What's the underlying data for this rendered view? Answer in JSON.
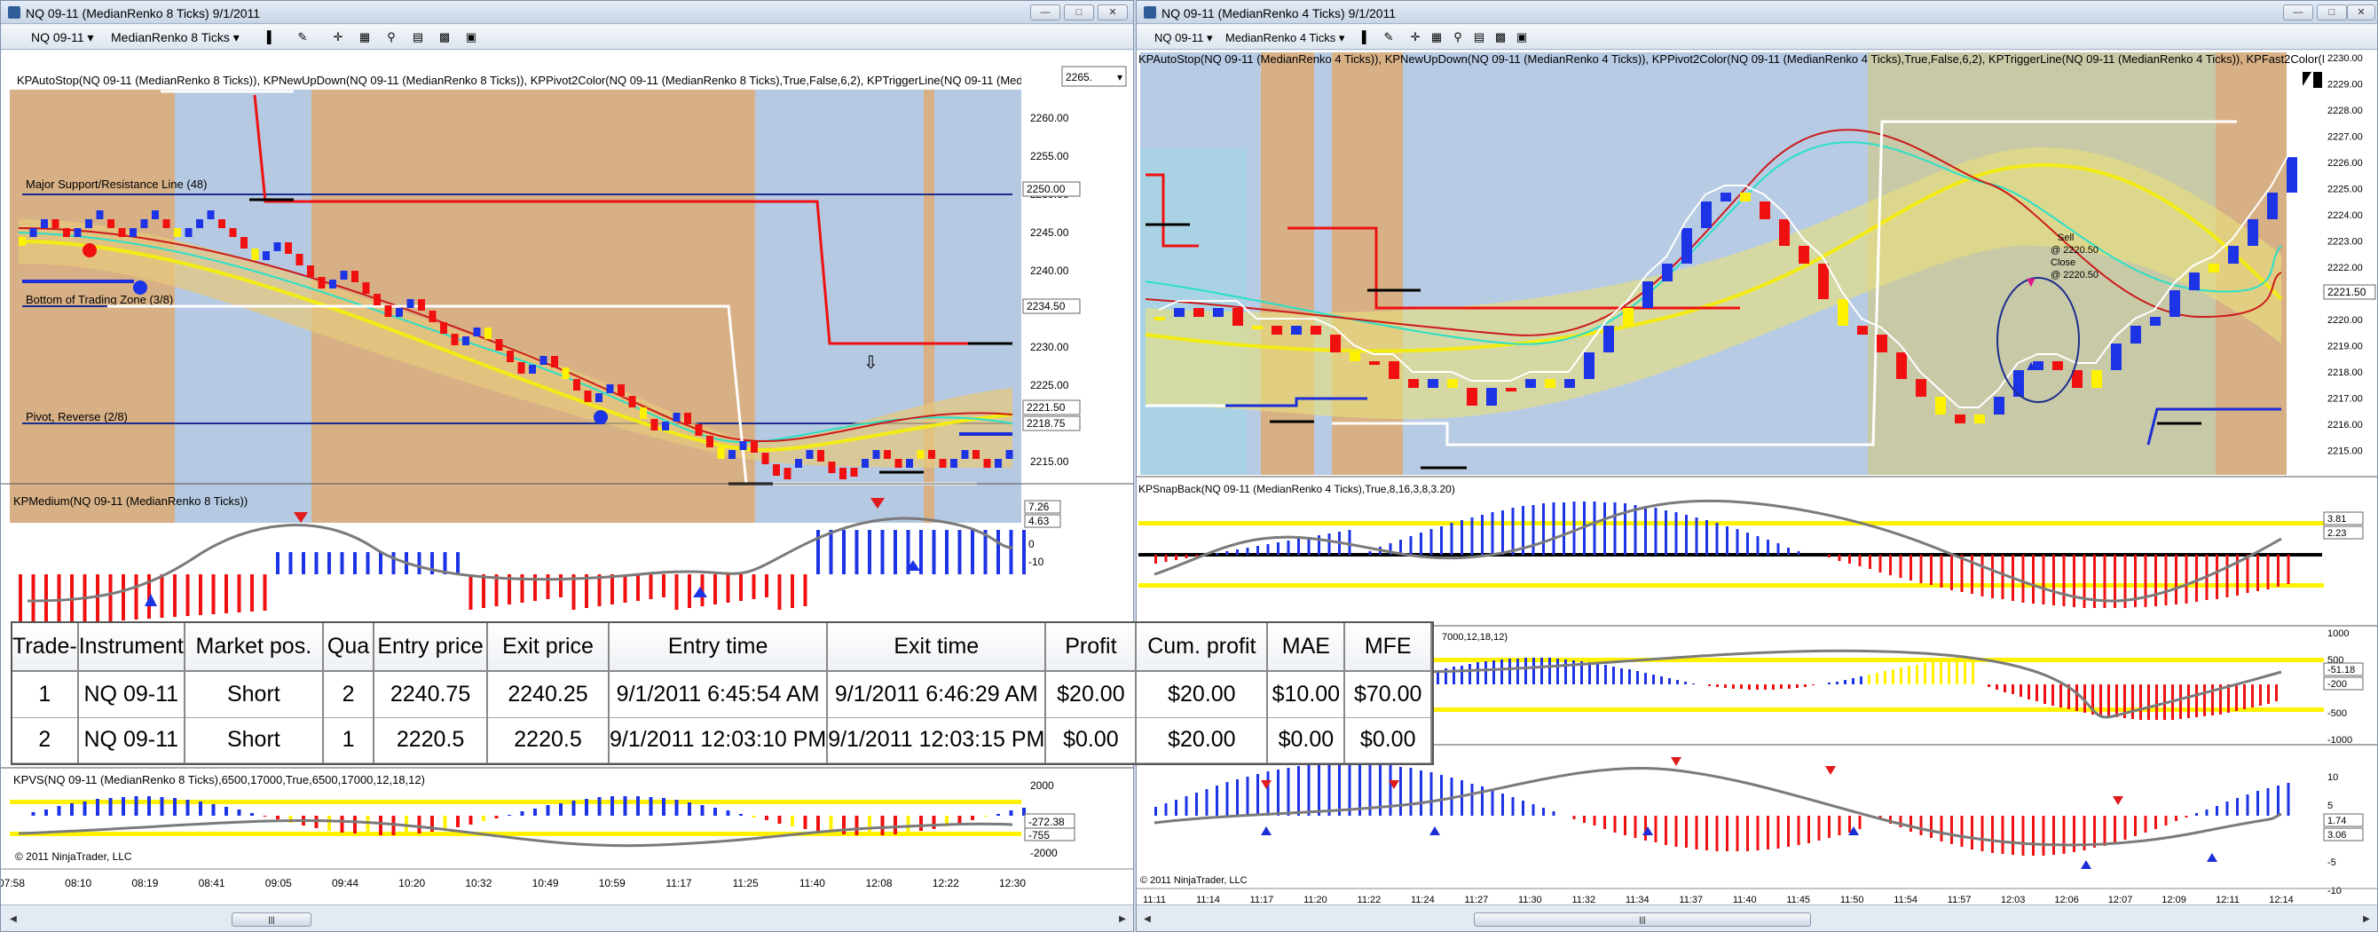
{
  "left_window": {
    "title": "NQ 09-11 (MedianRenko 8 Ticks)  9/1/2011",
    "toolbar": {
      "instrument": "NQ 09-11",
      "bar_type": "MedianRenko 8 Ticks"
    },
    "price_panel": {
      "indicators_label": "KPAutoStop(NQ 09-11 (MedianRenko 8 Ticks)), KPNewUpDown(NQ 09-11 (MedianRenko 8 Ticks)), KPPivot2Color(NQ 09-11 (MedianRenko 8 Ticks),True,False,6,2), KPTriggerLine(NQ 09-11 (MedianRenko 8 Ticks))",
      "line_labels": [
        "Major Support/Resistance Line (48)",
        "Bottom of Trading Zone (3/8)",
        "Pivot, Reverse (2/8)"
      ],
      "y_ticks": [
        "2260.00",
        "2255.00",
        "2250.00",
        "2245.00",
        "2240.00",
        "2235.00",
        "2230.00",
        "2225.00",
        "2220.00",
        "2215.00"
      ],
      "price_badges": [
        "2265.",
        "2250.00",
        "2234.50",
        "2221.50",
        "2218.75"
      ]
    },
    "medium_panel": {
      "label": "KPMedium(NQ 09-11 (MedianRenko 8 Ticks))",
      "y_badges": [
        "7.26",
        "4.63",
        "0",
        "-10"
      ]
    },
    "kpvs_panel": {
      "label": "KPVS(NQ 09-11 (MedianRenko 8 Ticks),6500,17000,True,6500,17000,12,18,12)",
      "y_ticks": [
        "2000",
        "-2000"
      ],
      "badges": [
        "-272.38",
        "-755"
      ]
    },
    "copyright": "© 2011 NinjaTrader, LLC",
    "x_ticks": [
      "07:58",
      "08:10",
      "08:19",
      "08:41",
      "09:05",
      "09:44",
      "10:20",
      "10:32",
      "10:49",
      "10:59",
      "11:17",
      "11:25",
      "11:40",
      "12:08",
      "12:22",
      "12:30"
    ]
  },
  "right_window": {
    "title": "NQ 09-11 (MedianRenko 4 Ticks)  9/1/2011",
    "toolbar": {
      "instrument": "NQ 09-11",
      "bar_type": "MedianRenko 4 Ticks"
    },
    "price_panel": {
      "indicators_label": "KPAutoStop(NQ 09-11 (MedianRenko 4 Ticks)), KPNewUpDown(NQ 09-11 (MedianRenko 4 Ticks)), KPPivot2Color(NQ 09-11 (MedianRenko 4 Ticks),True,False,6,2), KPTriggerLine(NQ 09-11 (MedianRenko 4 Ticks)), KPFast2Color(NQ 09-11 (MedianRenko 4 Ticks))",
      "y_ticks": [
        "2230.00",
        "2229.00",
        "2228.00",
        "2227.00",
        "2226.00",
        "2225.00",
        "2224.00",
        "2223.00",
        "2222.00",
        "2221.00",
        "2220.00",
        "2219.00",
        "2218.00",
        "2217.00",
        "2216.00",
        "2215.00"
      ],
      "price_badges": [
        "2221.50"
      ],
      "annotation": [
        "Sell",
        "@ 2220.50",
        "Close",
        "@ 2220.50"
      ]
    },
    "snapback_panel": {
      "label": "KPSnapBack(NQ 09-11 (MedianRenko 4 Ticks),True,8,16,3,8,3.20)",
      "badges": [
        "3.81",
        "2.23"
      ]
    },
    "kpvs_panel": {
      "label": "7000,12,18,12)",
      "y_ticks": [
        "1000",
        "500",
        "0",
        "-500",
        "-1000"
      ],
      "badges": [
        "-51.18",
        "-200"
      ]
    },
    "medium_panel": {
      "y_ticks": [
        "10",
        "5",
        "0",
        "-5",
        "-10"
      ],
      "badges": [
        "1.74",
        "3.06"
      ]
    },
    "copyright": "© 2011 NinjaTrader, LLC",
    "x_ticks": [
      "11:11",
      "11:14",
      "11:17",
      "11:20",
      "11:22",
      "11:24",
      "11:27",
      "11:30",
      "11:32",
      "11:34",
      "11:37",
      "11:40",
      "11:45",
      "11:50",
      "11:54",
      "11:57",
      "12:03",
      "12:06",
      "12:07",
      "12:09",
      "12:11",
      "12:14"
    ]
  },
  "trades_table": {
    "headers": [
      "Trade-",
      "Instrument",
      "Market pos.",
      "Qua",
      "Entry price",
      "Exit price",
      "Entry time",
      "Exit time",
      "Profit",
      "Cum. profit",
      "MAE",
      "MFE"
    ],
    "rows": [
      [
        "1",
        "NQ 09-11",
        "Short",
        "2",
        "2240.75",
        "2240.25",
        "9/1/2011 6:45:54 AM",
        "9/1/2011 6:46:29 AM",
        "$20.00",
        "$20.00",
        "$10.00",
        "$70.00"
      ],
      [
        "2",
        "NQ 09-11",
        "Short",
        "1",
        "2220.5",
        "2220.5",
        "9/1/2011 12:03:10 PM",
        "9/1/2011 12:03:15 PM",
        "$0.00",
        "$20.00",
        "$0.00",
        "$0.00"
      ]
    ]
  },
  "colors": {
    "up_bar": "#1d33e6",
    "down_bar": "#f01010",
    "yellow": "#fff200",
    "orange_zone": "#d6b086",
    "blue_zone": "#b3c8e2",
    "gray_zone": "#c5c9b8"
  }
}
